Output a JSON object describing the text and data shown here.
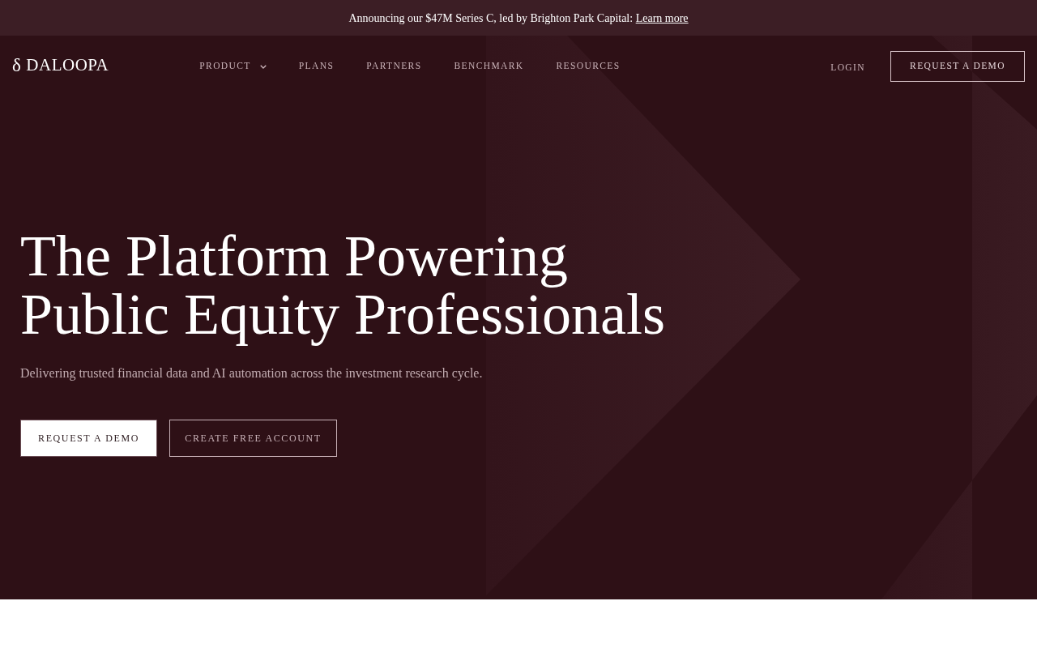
{
  "announcement": {
    "text": "Announcing our $47M Series C, led by Brighton Park Capital:",
    "link": "Learn more"
  },
  "navbar": {
    "logo": {
      "mark": "δ",
      "name": "DALOOPA"
    },
    "items": [
      {
        "label": "PRODUCT",
        "dropdown": true
      },
      {
        "label": "PLANS",
        "dropdown": false
      },
      {
        "label": "PARTNERS",
        "dropdown": false
      },
      {
        "label": "BENCHMARK",
        "dropdown": false
      },
      {
        "label": "RESOURCES",
        "dropdown": false
      }
    ],
    "login": "LOGIN",
    "cta": "REQUEST A DEMO"
  },
  "hero": {
    "title": "The Platform Powering Public Equity Professionals",
    "subtitle": "Delivering trusted financial data and AI automation across the investment research cycle.",
    "buttons": [
      {
        "label": "REQUEST A DEMO",
        "kind": "primary"
      },
      {
        "label": "CREATE FREE ACCOUNT",
        "kind": "outline"
      }
    ]
  }
}
